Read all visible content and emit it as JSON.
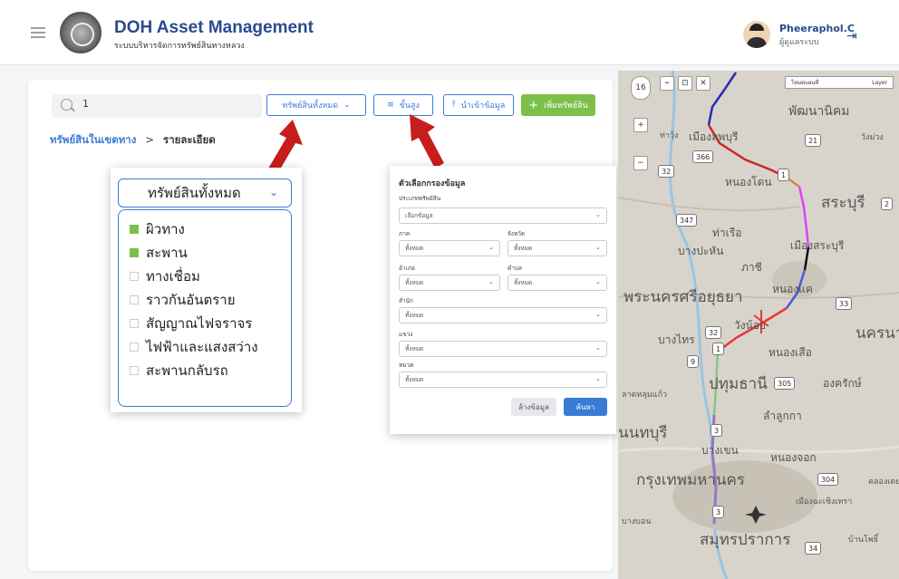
{
  "header": {
    "title": "DOH Asset Management",
    "subtitle": "ระบบบริหารจัดการทรัพย์สินทางหลวง",
    "user_name": "Pheeraphol.C",
    "user_role": "ผู้ดูแลระบบ"
  },
  "toolbar": {
    "search_value": "1",
    "asset_filter_label": "ทรัพย์สินทั้งหมด",
    "advanced_label": "ขั้นสูง",
    "import_label": "นำเข้าข้อมูล",
    "add_label": "เพิ่มทรัพย์สิน"
  },
  "breadcrumb": {
    "parent": "ทรัพย์สินในเขตทาง",
    "separator": ">",
    "current": "รายละเอียด"
  },
  "asset_dropdown": {
    "selected": "ทรัพย์สินทั้งหมด",
    "items": [
      {
        "label": "ผิวทาง",
        "checked": true
      },
      {
        "label": "สะพาน",
        "checked": true
      },
      {
        "label": "ทางเชื่อม",
        "checked": false
      },
      {
        "label": "ราวกันอันตราย",
        "checked": false
      },
      {
        "label": "สัญญาณไฟจราจร",
        "checked": false
      },
      {
        "label": "ไฟฟ้าและแสงสว่าง",
        "checked": false
      },
      {
        "label": "สะพานกลับรถ",
        "checked": false
      }
    ]
  },
  "filter_panel": {
    "title": "ตัวเลือกกรองข้อมูล",
    "asset_type_label": "ประเภททรัพย์สิน",
    "asset_type_value": "เลือกข้อมูล",
    "region_label": "ภาค",
    "region_value": "ทั้งหมด",
    "province_label": "จังหวัด",
    "province_value": "ทั้งหมด",
    "district_label": "อำเภอ",
    "district_value": "ทั้งหมด",
    "subdistrict_label": "ตำบล",
    "subdistrict_value": "ทั้งหมด",
    "bureau_label": "สำนัก",
    "bureau_value": "ทั้งหมด",
    "office_label": "แขวง",
    "office_value": "ทั้งหมด",
    "unit_label": "หมวด",
    "unit_value": "ทั้งหมด",
    "clear_label": "ล้างข้อมูล",
    "search_label": "ค้นหา"
  },
  "map": {
    "zoom": "16",
    "layer_label": "Layer",
    "basemap_label": "โหมดแผนที่",
    "places": [
      "พัฒนานิคม",
      "ท่าวุ้ง",
      "เมืองลพบุรี",
      "หนองโดน",
      "สระบุรี",
      "วังม่วง",
      "ท่าเรือ",
      "บางปะหัน",
      "ภาชี",
      "เมืองสระบุรี",
      "พระนครศรีอยุธยา",
      "หนองแค",
      "วังน้อย",
      "บางไทร",
      "หนองเสือ",
      "นครนายก",
      "ปทุมธานี",
      "องครักษ์",
      "ลาดหลุมแก้ว",
      "ลำลูกกา",
      "นนทบุรี",
      "บางเขน",
      "หนองจอก",
      "กรุงเทพมหานคร",
      "คลองเตย",
      "เมืองฉะเชิงเทรา",
      "บางบอน",
      "สมุทรปราการ",
      "บ้านโพธิ์"
    ],
    "route_shields": [
      "21",
      "366",
      "1",
      "32",
      "347",
      "2",
      "33",
      "32",
      "1",
      "9",
      "305",
      "304",
      "3",
      "3",
      "34"
    ]
  },
  "colors": {
    "primary": "#3a7bd5",
    "green": "#7cc04a",
    "title": "#2a4b8f",
    "arrow": "#c81d1d"
  }
}
